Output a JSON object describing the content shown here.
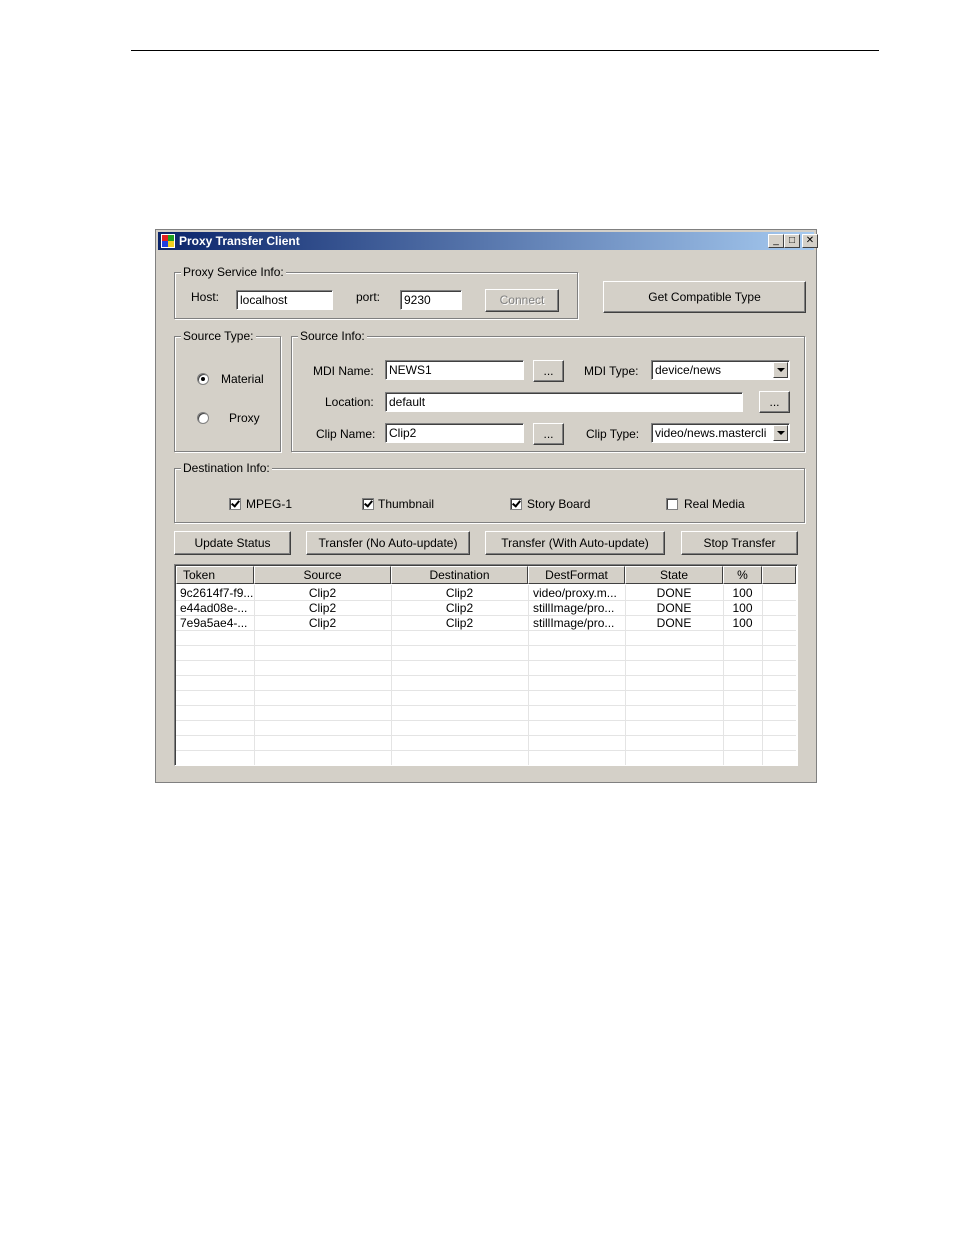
{
  "window": {
    "title": "Proxy Transfer Client"
  },
  "proxy_service": {
    "group_label": "Proxy Service Info:",
    "host_label": "Host:",
    "host_value": "localhost",
    "port_label": "port:",
    "port_value": "9230",
    "connect_label": "Connect"
  },
  "get_compatible_label": "Get Compatible Type",
  "source_type": {
    "group_label": "Source Type:",
    "material_label": "Material",
    "proxy_label": "Proxy",
    "selected": "Material"
  },
  "source_info": {
    "group_label": "Source Info:",
    "mdi_name_label": "MDI Name:",
    "mdi_name_value": "NEWS1",
    "mdi_type_label": "MDI Type:",
    "mdi_type_value": "device/news",
    "location_label": "Location:",
    "location_value": "default",
    "clip_name_label": "Clip Name:",
    "clip_name_value": "Clip2",
    "clip_type_label": "Clip Type:",
    "clip_type_value": "video/news.mastercli",
    "browse_label": "..."
  },
  "destination": {
    "group_label": "Destination Info:",
    "options": [
      {
        "label": "MPEG-1",
        "checked": true
      },
      {
        "label": "Thumbnail",
        "checked": true
      },
      {
        "label": "Story Board",
        "checked": true
      },
      {
        "label": "Real Media",
        "checked": false
      }
    ]
  },
  "actions": {
    "update_status": "Update Status",
    "transfer_no_auto": "Transfer (No Auto-update)",
    "transfer_auto": "Transfer (With Auto-update)",
    "stop_transfer": "Stop Transfer"
  },
  "table": {
    "headers": [
      "Token",
      "Source",
      "Destination",
      "DestFormat",
      "State",
      "%"
    ],
    "rows": [
      [
        "9c2614f7-f9...",
        "Clip2",
        "Clip2",
        "video/proxy.m...",
        "DONE",
        "100"
      ],
      [
        "e44ad08e-...",
        "Clip2",
        "Clip2",
        "stillImage/pro...",
        "DONE",
        "100"
      ],
      [
        "7e9a5ae4-...",
        "Clip2",
        "Clip2",
        "stillImage/pro...",
        "DONE",
        "100"
      ]
    ]
  }
}
